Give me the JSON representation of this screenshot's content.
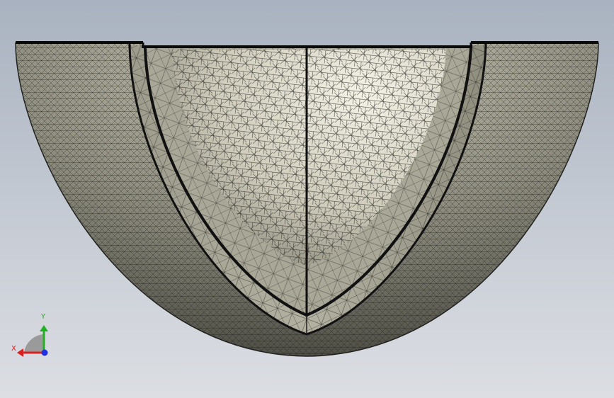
{
  "viewport": {
    "background_top": "#a9b2c0",
    "background_bottom": "#dcdee3"
  },
  "model": {
    "type": "hemispherical-shell-section-mesh",
    "outer_shell_color": "#8e8d7f",
    "outer_shell_dark": "#55554c",
    "middle_shell_color": "#a8a697",
    "inner_cavity_color": "#e6e3d3",
    "mesh_line_color": "#1d1d1a"
  },
  "triad": {
    "x_label": "X",
    "y_label": "Y",
    "x_color": "#d92020",
    "y_color": "#22b022",
    "z_color": "#2030e0"
  }
}
